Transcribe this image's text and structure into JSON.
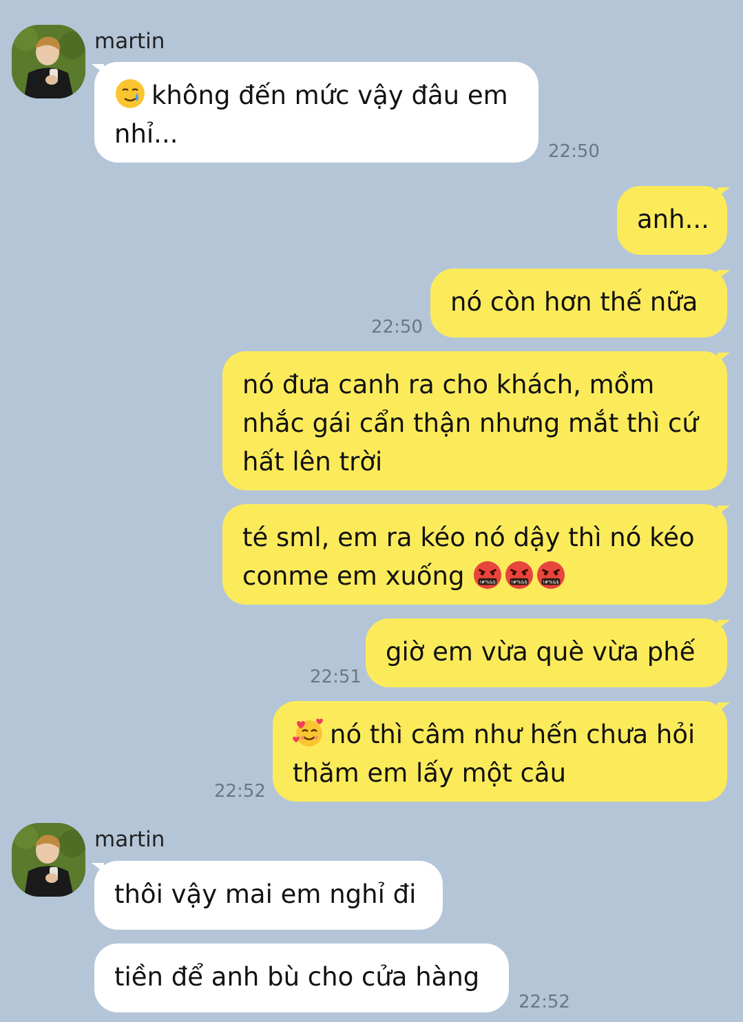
{
  "messages": [
    {
      "sender": "martin",
      "text": "không đến mức vậy đâu em nhỉ...",
      "emoji": "smiling-face-with-tear",
      "time": "22:50"
    },
    {
      "text": "anh..."
    },
    {
      "text": "nó còn hơn thế nữa",
      "time": "22:50"
    },
    {
      "text": "nó đưa canh ra cho khách, mồm nhắc gái cẩn thận nhưng mắt thì cứ hất lên trời"
    },
    {
      "text_1": "té sml, em ra kéo nó dậy thì nó kéo",
      "text_2": "conme em xuống",
      "emoji": "face-with-symbols-on-mouth",
      "emoji_count": 3
    },
    {
      "text": "giờ em vừa què vừa phế",
      "time": "22:51"
    },
    {
      "text": "nó thì câm như hến chưa hỏi thăm em lấy một câu",
      "emoji": "smiling-face-with-hearts",
      "time": "22:52"
    },
    {
      "sender": "martin",
      "text": "thôi vậy mai em nghỉ đi"
    },
    {
      "text": "tiền để anh bù cho cửa hàng",
      "time": "22:52"
    }
  ],
  "colors": {
    "background": "#b5c5d8",
    "incoming": "#ffffff",
    "outgoing": "#fbeb5b",
    "timestamp": "#6b7682"
  }
}
